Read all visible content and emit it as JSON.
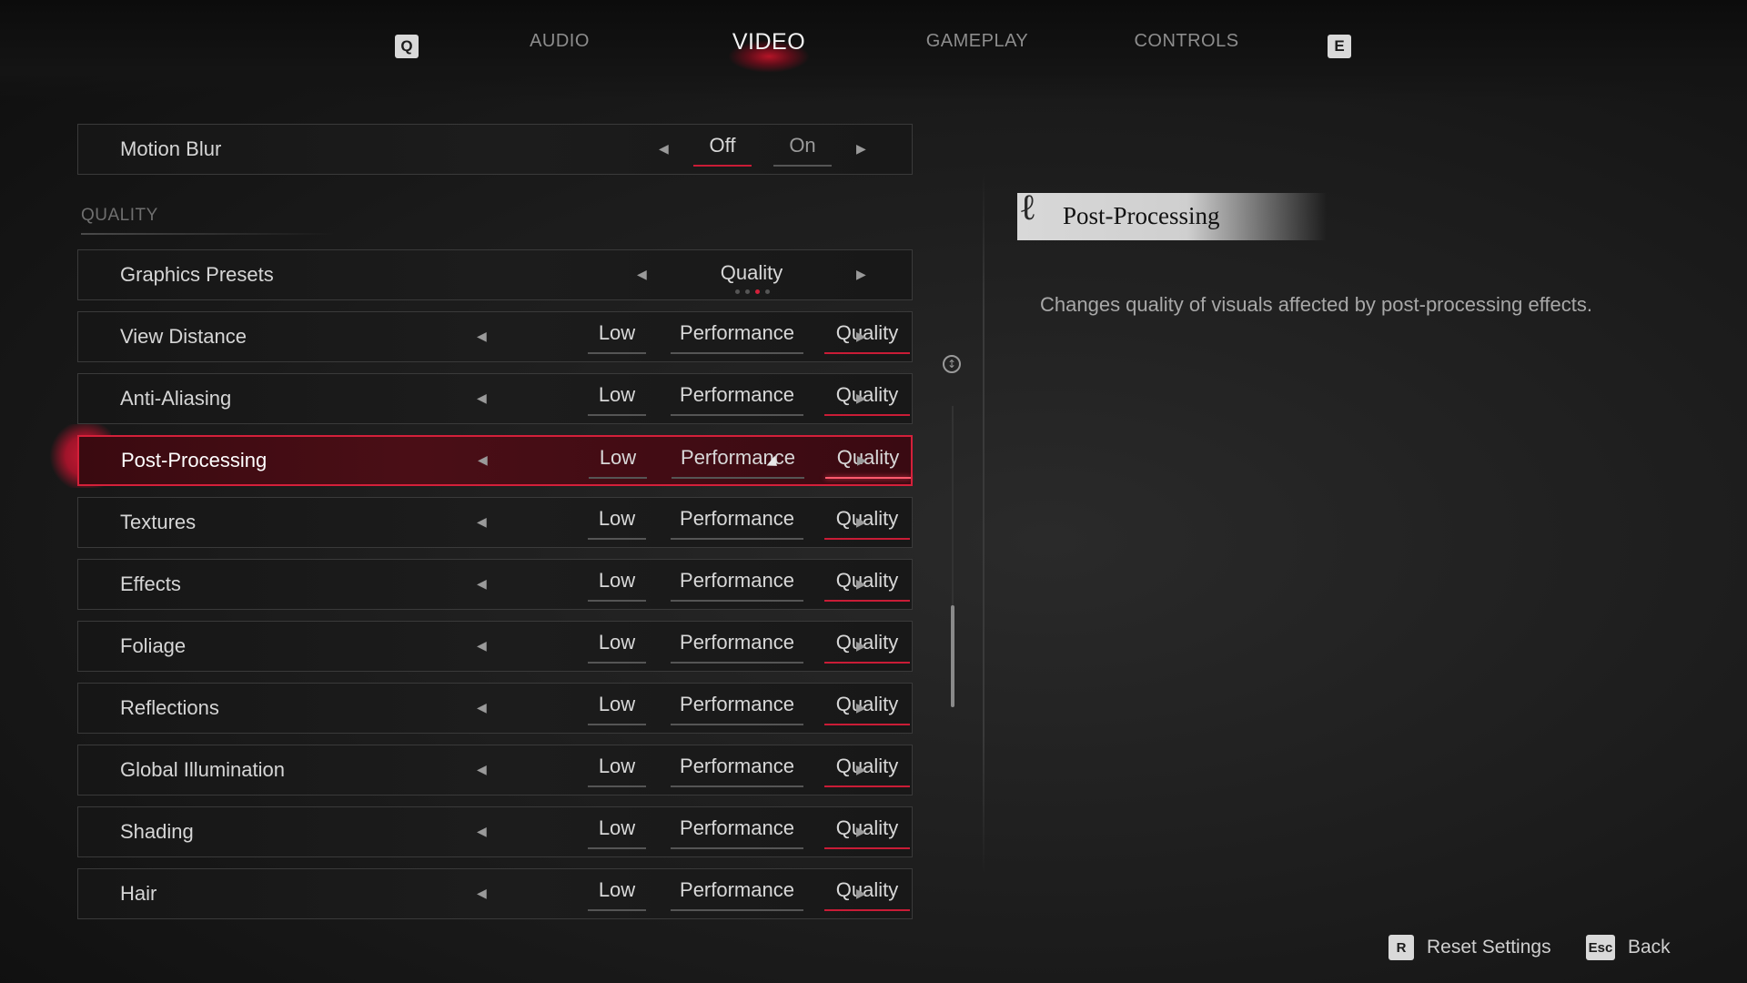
{
  "tabs": {
    "prev_key": "Q",
    "next_key": "E",
    "items": [
      {
        "label": "AUDIO"
      },
      {
        "label": "VIDEO",
        "active": true
      },
      {
        "label": "GAMEPLAY"
      },
      {
        "label": "CONTROLS"
      }
    ]
  },
  "motion_blur": {
    "label": "Motion Blur",
    "options": [
      "Off",
      "On"
    ],
    "selected": "Off"
  },
  "section": {
    "label": "QUALITY"
  },
  "presets": {
    "label": "Graphics Presets",
    "value": "Quality",
    "page_count": 4,
    "page_index": 2
  },
  "settings": [
    {
      "label": "View Distance",
      "options": [
        "Low",
        "Performance",
        "Quality"
      ],
      "selected": "Quality"
    },
    {
      "label": "Anti-Aliasing",
      "options": [
        "Low",
        "Performance",
        "Quality"
      ],
      "selected": "Quality"
    },
    {
      "label": "Post-Processing",
      "options": [
        "Low",
        "Performance",
        "Quality"
      ],
      "selected": "Quality",
      "focused": true
    },
    {
      "label": "Textures",
      "options": [
        "Low",
        "Performance",
        "Quality"
      ],
      "selected": "Quality"
    },
    {
      "label": "Effects",
      "options": [
        "Low",
        "Performance",
        "Quality"
      ],
      "selected": "Quality"
    },
    {
      "label": "Foliage",
      "options": [
        "Low",
        "Performance",
        "Quality"
      ],
      "selected": "Quality"
    },
    {
      "label": "Reflections",
      "options": [
        "Low",
        "Performance",
        "Quality"
      ],
      "selected": "Quality"
    },
    {
      "label": "Global Illumination",
      "options": [
        "Low",
        "Performance",
        "Quality"
      ],
      "selected": "Quality"
    },
    {
      "label": "Shading",
      "options": [
        "Low",
        "Performance",
        "Quality"
      ],
      "selected": "Quality"
    },
    {
      "label": "Hair",
      "options": [
        "Low",
        "Performance",
        "Quality"
      ],
      "selected": "Quality"
    }
  ],
  "info": {
    "title": "Post-Processing",
    "description": "Changes quality of visuals affected by post-processing effects."
  },
  "footer": {
    "reset": {
      "key": "R",
      "label": "Reset Settings"
    },
    "back": {
      "key": "Esc",
      "label": "Back"
    }
  },
  "colors": {
    "accent": "#d4203a",
    "text": "#d8d8d8",
    "background": "#1b1b1b"
  }
}
